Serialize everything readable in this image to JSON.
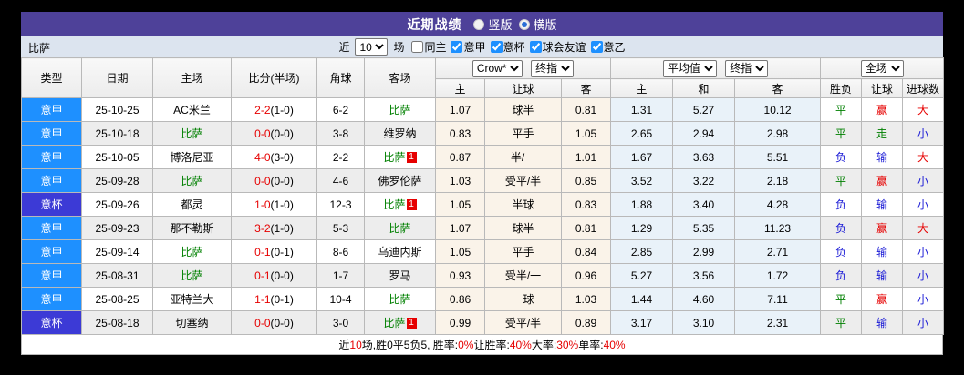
{
  "title_bar": {
    "title": "近期战绩",
    "options": [
      {
        "label": "竖版",
        "selected": false
      },
      {
        "label": "横版",
        "selected": true
      }
    ]
  },
  "filter_bar": {
    "team": "比萨",
    "near_label": "近",
    "count_value": "10",
    "games_label": "场",
    "filters": [
      {
        "label": "同主",
        "checked": false
      },
      {
        "label": "意甲",
        "checked": true
      },
      {
        "label": "意杯",
        "checked": true
      },
      {
        "label": "球会友谊",
        "checked": true
      },
      {
        "label": "意乙",
        "checked": true
      }
    ]
  },
  "table": {
    "columns": [
      "类型",
      "日期",
      "主场",
      "比分(半场)",
      "角球",
      "客场"
    ],
    "asia_group": {
      "bookmaker_dropdown": "Crow*",
      "stage_dropdown": "终指",
      "subcols": [
        "主",
        "让球",
        "客"
      ]
    },
    "euro_group": {
      "bookmaker_dropdown": "平均值",
      "stage_dropdown": "终指",
      "subcols": [
        "主",
        "和",
        "客"
      ]
    },
    "result_group": {
      "scope_dropdown": "全场",
      "subcols": [
        "胜负",
        "让球",
        "进球数"
      ]
    },
    "rows": [
      {
        "type": "意甲",
        "kind": "league",
        "date": "25-10-25",
        "home": "AC米兰",
        "home_hl": false,
        "score": "2-2",
        "half": "(1-0)",
        "corners": "6-2",
        "away": "比萨",
        "away_hl": true,
        "red_card": "",
        "asia": [
          "1.07",
          "球半",
          "0.81"
        ],
        "euro": [
          "1.31",
          "5.27",
          "10.12"
        ],
        "result": "平",
        "handicap": "赢",
        "goals": "大"
      },
      {
        "type": "意甲",
        "kind": "league",
        "date": "25-10-18",
        "home": "比萨",
        "home_hl": true,
        "score": "0-0",
        "half": "(0-0)",
        "corners": "3-8",
        "away": "维罗纳",
        "away_hl": false,
        "red_card": "",
        "asia": [
          "0.83",
          "平手",
          "1.05"
        ],
        "euro": [
          "2.65",
          "2.94",
          "2.98"
        ],
        "result": "平",
        "handicap": "走",
        "goals": "小"
      },
      {
        "type": "意甲",
        "kind": "league",
        "date": "25-10-05",
        "home": "博洛尼亚",
        "home_hl": false,
        "score": "4-0",
        "half": "(3-0)",
        "corners": "2-2",
        "away": "比萨",
        "away_hl": true,
        "red_card": "1",
        "asia": [
          "0.87",
          "半/一",
          "1.01"
        ],
        "euro": [
          "1.67",
          "3.63",
          "5.51"
        ],
        "result": "负",
        "handicap": "输",
        "goals": "大"
      },
      {
        "type": "意甲",
        "kind": "league",
        "date": "25-09-28",
        "home": "比萨",
        "home_hl": true,
        "score": "0-0",
        "half": "(0-0)",
        "corners": "4-6",
        "away": "佛罗伦萨",
        "away_hl": false,
        "red_card": "",
        "asia": [
          "1.03",
          "受平/半",
          "0.85"
        ],
        "euro": [
          "3.52",
          "3.22",
          "2.18"
        ],
        "result": "平",
        "handicap": "赢",
        "goals": "小"
      },
      {
        "type": "意杯",
        "kind": "cup",
        "date": "25-09-26",
        "home": "都灵",
        "home_hl": false,
        "score": "1-0",
        "half": "(1-0)",
        "corners": "12-3",
        "away": "比萨",
        "away_hl": true,
        "red_card": "1",
        "asia": [
          "1.05",
          "半球",
          "0.83"
        ],
        "euro": [
          "1.88",
          "3.40",
          "4.28"
        ],
        "result": "负",
        "handicap": "输",
        "goals": "小"
      },
      {
        "type": "意甲",
        "kind": "league",
        "date": "25-09-23",
        "home": "那不勒斯",
        "home_hl": false,
        "score": "3-2",
        "half": "(1-0)",
        "corners": "5-3",
        "away": "比萨",
        "away_hl": true,
        "red_card": "",
        "asia": [
          "1.07",
          "球半",
          "0.81"
        ],
        "euro": [
          "1.29",
          "5.35",
          "11.23"
        ],
        "result": "负",
        "handicap": "赢",
        "goals": "大"
      },
      {
        "type": "意甲",
        "kind": "league",
        "date": "25-09-14",
        "home": "比萨",
        "home_hl": true,
        "score": "0-1",
        "half": "(0-1)",
        "corners": "8-6",
        "away": "乌迪内斯",
        "away_hl": false,
        "red_card": "",
        "asia": [
          "1.05",
          "平手",
          "0.84"
        ],
        "euro": [
          "2.85",
          "2.99",
          "2.71"
        ],
        "result": "负",
        "handicap": "输",
        "goals": "小"
      },
      {
        "type": "意甲",
        "kind": "league",
        "date": "25-08-31",
        "home": "比萨",
        "home_hl": true,
        "score": "0-1",
        "half": "(0-0)",
        "corners": "1-7",
        "away": "罗马",
        "away_hl": false,
        "red_card": "",
        "asia": [
          "0.93",
          "受半/一",
          "0.96"
        ],
        "euro": [
          "5.27",
          "3.56",
          "1.72"
        ],
        "result": "负",
        "handicap": "输",
        "goals": "小"
      },
      {
        "type": "意甲",
        "kind": "league",
        "date": "25-08-25",
        "home": "亚特兰大",
        "home_hl": false,
        "score": "1-1",
        "half": "(0-1)",
        "corners": "10-4",
        "away": "比萨",
        "away_hl": true,
        "red_card": "",
        "asia": [
          "0.86",
          "一球",
          "1.03"
        ],
        "euro": [
          "1.44",
          "4.60",
          "7.11"
        ],
        "result": "平",
        "handicap": "赢",
        "goals": "小"
      },
      {
        "type": "意杯",
        "kind": "cup",
        "date": "25-08-18",
        "home": "切塞纳",
        "home_hl": false,
        "score": "0-0",
        "half": "(0-0)",
        "corners": "3-0",
        "away": "比萨",
        "away_hl": true,
        "red_card": "1",
        "asia": [
          "0.99",
          "受平/半",
          "0.89"
        ],
        "euro": [
          "3.17",
          "3.10",
          "2.31"
        ],
        "result": "平",
        "handicap": "输",
        "goals": "小"
      }
    ]
  },
  "footer": {
    "segments": [
      {
        "text": "近",
        "red": false
      },
      {
        "text": "10",
        "red": true
      },
      {
        "text": "场,胜0平5负5, 胜率:",
        "red": false
      },
      {
        "text": "0%",
        "red": true
      },
      {
        "text": " 让胜率:",
        "red": false
      },
      {
        "text": "40%",
        "red": true
      },
      {
        "text": " 大率:",
        "red": false
      },
      {
        "text": "30%",
        "red": true
      },
      {
        "text": " 单率:",
        "red": false
      },
      {
        "text": "40%",
        "red": true
      }
    ]
  },
  "colors": {
    "title_bar_bg": "#4e4199",
    "filter_bar_bg": "#dce4ef",
    "league_type_bg": "#1e90ff",
    "cup_type_bg": "#3c3ad6",
    "team_highlight": "#008000",
    "score_red": "#e60000",
    "asia_col_bg": "#faf3e9",
    "euro_col_bg": "#e9f2f9"
  },
  "value_colors": {
    "平": "#008000",
    "负": "#1a1ad6",
    "胜": "#e60000",
    "赢": "#e60000",
    "输": "#1a1ad6",
    "走": "#008000",
    "大": "#e60000",
    "小": "#1a1ad6"
  }
}
